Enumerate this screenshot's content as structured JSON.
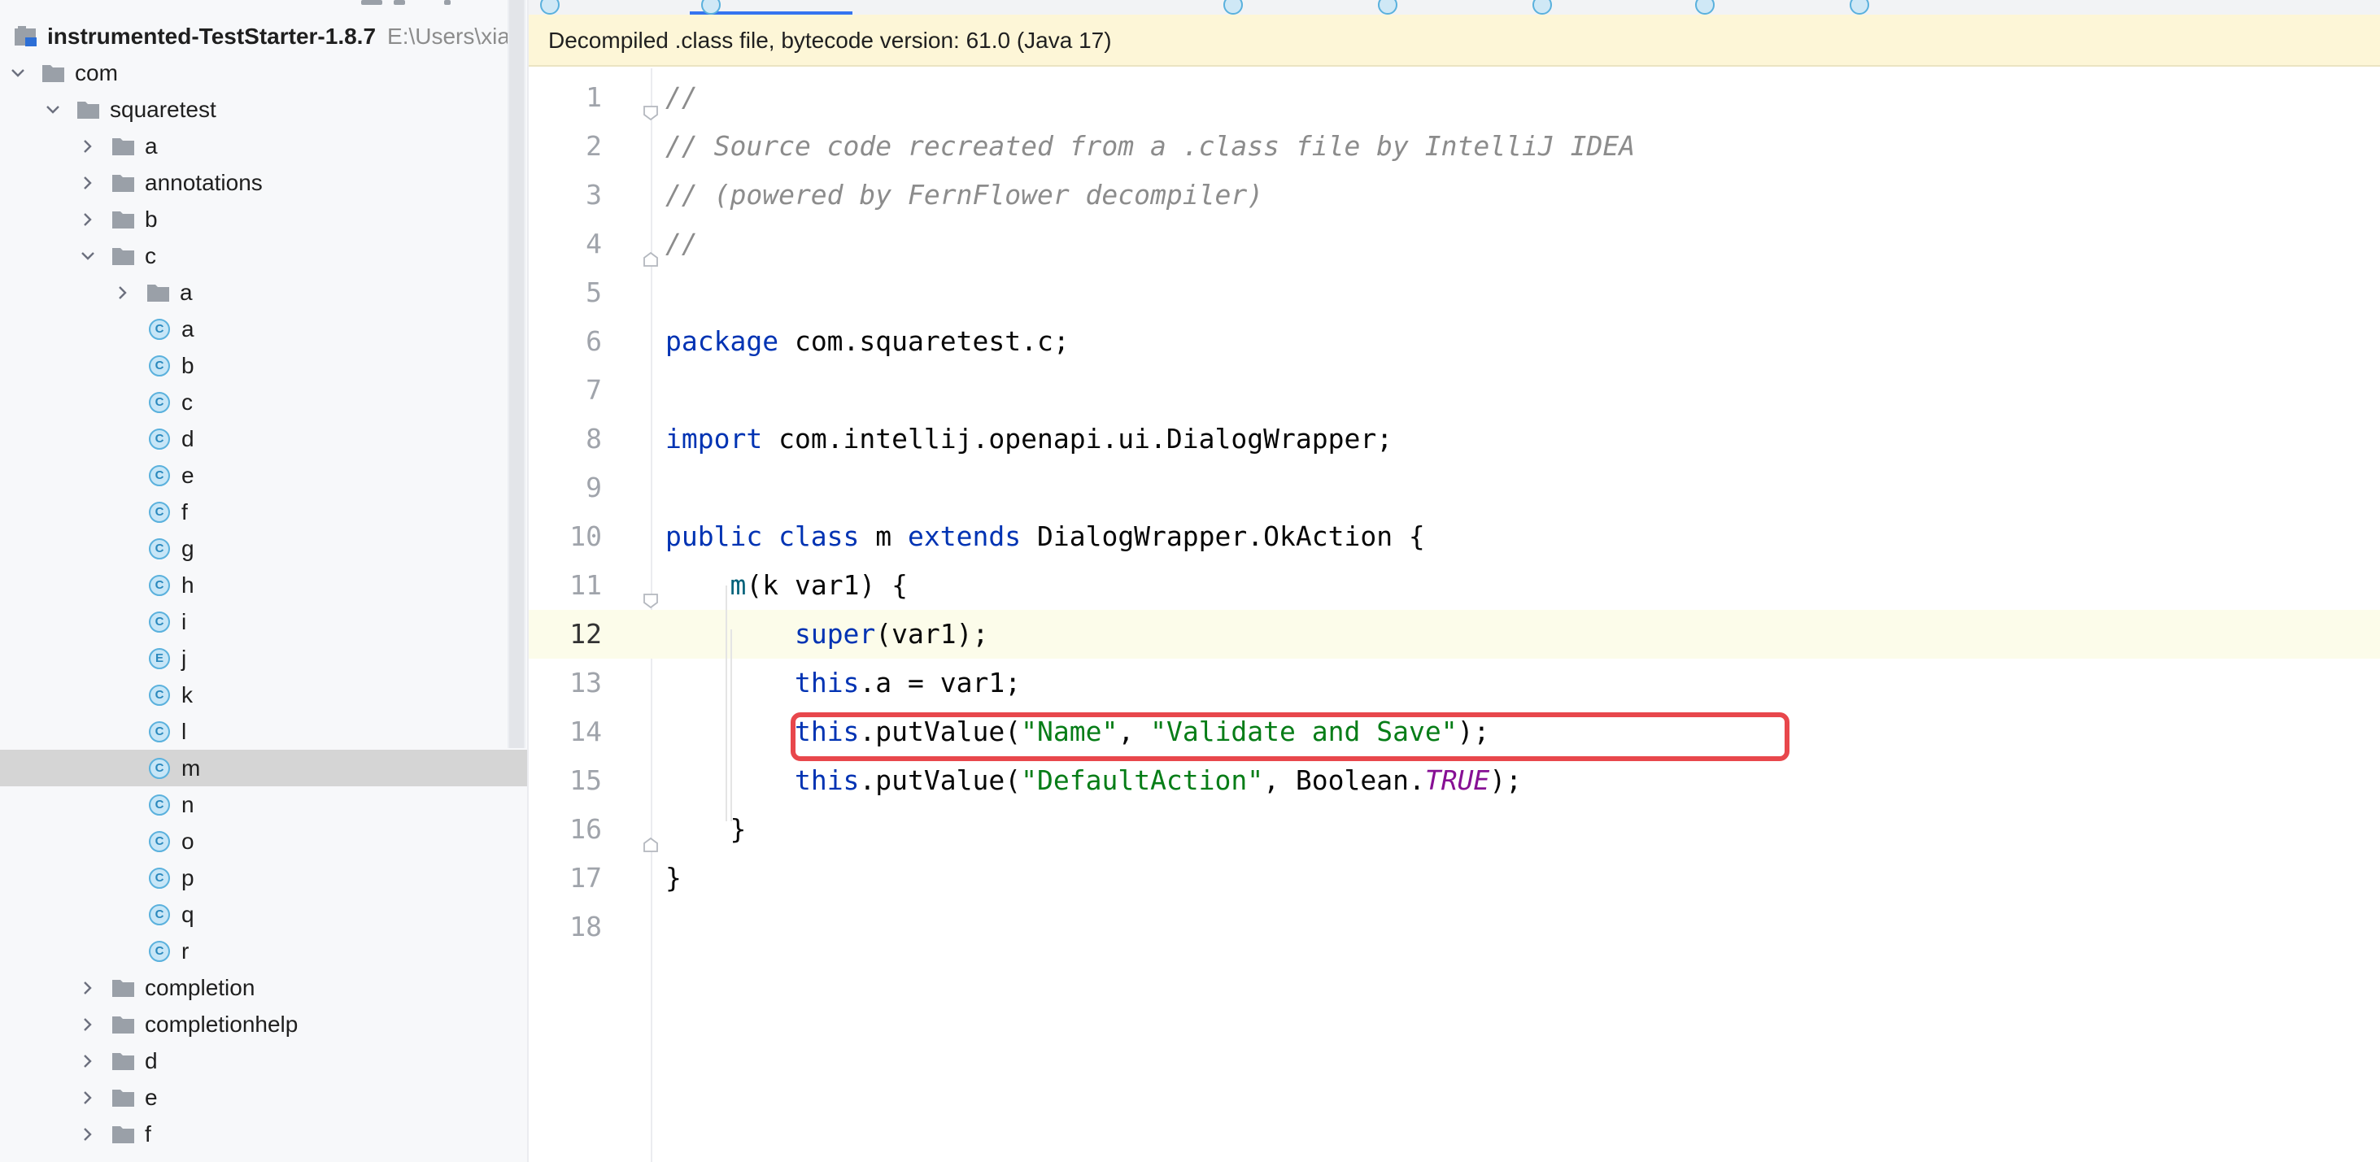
{
  "project_tree": {
    "root_label": "instrumented-TestStarter-1.8.7",
    "root_path": "E:\\Users\\xia",
    "items": [
      {
        "label": "com",
        "kind": "folder",
        "depth": 1,
        "expanded": true
      },
      {
        "label": "squaretest",
        "kind": "folder",
        "depth": 2,
        "expanded": true
      },
      {
        "label": "a",
        "kind": "folder",
        "depth": 3,
        "expanded": false
      },
      {
        "label": "annotations",
        "kind": "folder",
        "depth": 3,
        "expanded": false
      },
      {
        "label": "b",
        "kind": "folder",
        "depth": 3,
        "expanded": false
      },
      {
        "label": "c",
        "kind": "folder",
        "depth": 3,
        "expanded": true
      },
      {
        "label": "a",
        "kind": "folder",
        "depth": 4,
        "expanded": false
      },
      {
        "label": "a",
        "kind": "class",
        "badge": "C",
        "depth": 4
      },
      {
        "label": "b",
        "kind": "class",
        "badge": "C",
        "depth": 4
      },
      {
        "label": "c",
        "kind": "class",
        "badge": "C",
        "depth": 4
      },
      {
        "label": "d",
        "kind": "class",
        "badge": "C",
        "depth": 4
      },
      {
        "label": "e",
        "kind": "class",
        "badge": "C",
        "depth": 4
      },
      {
        "label": "f",
        "kind": "class",
        "badge": "C",
        "depth": 4
      },
      {
        "label": "g",
        "kind": "class",
        "badge": "C",
        "depth": 4
      },
      {
        "label": "h",
        "kind": "class",
        "badge": "C",
        "depth": 4
      },
      {
        "label": "i",
        "kind": "class",
        "badge": "C",
        "depth": 4
      },
      {
        "label": "j",
        "kind": "class",
        "badge": "E",
        "depth": 4
      },
      {
        "label": "k",
        "kind": "class",
        "badge": "C",
        "depth": 4
      },
      {
        "label": "l",
        "kind": "class",
        "badge": "C",
        "depth": 4
      },
      {
        "label": "m",
        "kind": "class",
        "badge": "C",
        "depth": 4,
        "selected": true
      },
      {
        "label": "n",
        "kind": "class",
        "badge": "C",
        "depth": 4
      },
      {
        "label": "o",
        "kind": "class",
        "badge": "C",
        "depth": 4
      },
      {
        "label": "p",
        "kind": "class",
        "badge": "C",
        "depth": 4
      },
      {
        "label": "q",
        "kind": "class",
        "badge": "C",
        "depth": 4
      },
      {
        "label": "r",
        "kind": "class",
        "badge": "C",
        "depth": 4
      },
      {
        "label": "completion",
        "kind": "folder",
        "depth": 3,
        "expanded": false
      },
      {
        "label": "completionhelp",
        "kind": "folder",
        "depth": 3,
        "expanded": false
      },
      {
        "label": "d",
        "kind": "folder",
        "depth": 3,
        "expanded": false
      },
      {
        "label": "e",
        "kind": "folder",
        "depth": 3,
        "expanded": false
      },
      {
        "label": "f",
        "kind": "folder",
        "depth": 3,
        "expanded": false
      }
    ]
  },
  "editor": {
    "banner": "Decompiled .class file, bytecode version: 61.0 (Java 17)",
    "current_line": 12,
    "highlighted_line": 14,
    "lines": [
      {
        "n": "1",
        "tokens": [
          [
            "cm",
            "//"
          ]
        ],
        "fold": "start"
      },
      {
        "n": "2",
        "tokens": [
          [
            "cm",
            "// Source code recreated from a .class file by IntelliJ IDEA"
          ]
        ]
      },
      {
        "n": "3",
        "tokens": [
          [
            "cm",
            "// (powered by FernFlower decompiler)"
          ]
        ]
      },
      {
        "n": "4",
        "tokens": [
          [
            "cm",
            "//"
          ]
        ],
        "fold": "end"
      },
      {
        "n": "5",
        "tokens": []
      },
      {
        "n": "6",
        "tokens": [
          [
            "kw",
            "package"
          ],
          [
            "",
            " com.squaretest.c;"
          ]
        ]
      },
      {
        "n": "7",
        "tokens": []
      },
      {
        "n": "8",
        "tokens": [
          [
            "kw",
            "import"
          ],
          [
            "",
            " com.intellij.openapi.ui.DialogWrapper;"
          ]
        ]
      },
      {
        "n": "9",
        "tokens": []
      },
      {
        "n": "10",
        "tokens": [
          [
            "kw",
            "public class"
          ],
          [
            "",
            " m "
          ],
          [
            "kw",
            "extends"
          ],
          [
            "",
            " DialogWrapper.OkAction {"
          ]
        ]
      },
      {
        "n": "11",
        "tokens": [
          [
            "",
            "    "
          ],
          [
            "fn",
            "m"
          ],
          [
            "",
            "(k var1) {"
          ]
        ],
        "fold": "start"
      },
      {
        "n": "12",
        "tokens": [
          [
            "",
            "        "
          ],
          [
            "kw",
            "super"
          ],
          [
            "",
            "(var1);"
          ]
        ]
      },
      {
        "n": "13",
        "tokens": [
          [
            "",
            "        "
          ],
          [
            "kw",
            "this"
          ],
          [
            "",
            ".a = var1;"
          ]
        ]
      },
      {
        "n": "14",
        "tokens": [
          [
            "",
            "        "
          ],
          [
            "kw",
            "this"
          ],
          [
            "",
            ".putValue("
          ],
          [
            "str",
            "\"Name\""
          ],
          [
            "",
            ", "
          ],
          [
            "str",
            "\"Validate and Save\""
          ],
          [
            "",
            ");"
          ]
        ]
      },
      {
        "n": "15",
        "tokens": [
          [
            "",
            "        "
          ],
          [
            "kw",
            "this"
          ],
          [
            "",
            ".putValue("
          ],
          [
            "str",
            "\"DefaultAction\""
          ],
          [
            "",
            ", Boolean."
          ],
          [
            "cst",
            "TRUE"
          ],
          [
            "",
            ");"
          ]
        ]
      },
      {
        "n": "16",
        "tokens": [
          [
            "",
            "    }"
          ]
        ],
        "fold": "end"
      },
      {
        "n": "17",
        "tokens": [
          [
            "",
            "}"
          ]
        ]
      },
      {
        "n": "18",
        "tokens": []
      }
    ]
  },
  "colors": {
    "keyword": "#0033b3",
    "string": "#067d17",
    "comment": "#8c8c8c",
    "method": "#00627a",
    "constant": "#871094",
    "highlight_box": "#e8474c",
    "banner_bg": "#fdf6d7"
  }
}
